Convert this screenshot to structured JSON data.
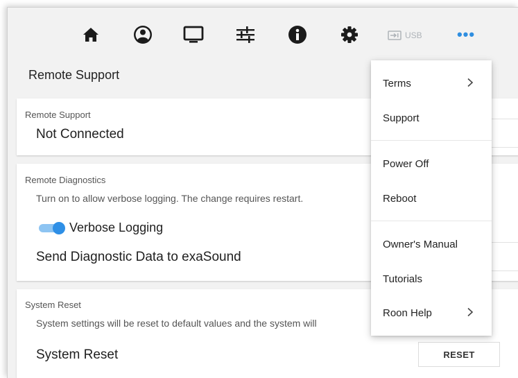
{
  "toolbar": {
    "icons": [
      "home-icon",
      "profile-icon",
      "monitor-icon",
      "sliders-icon",
      "info-icon",
      "gear-icon"
    ],
    "usb_label": "USB",
    "more_label": "•••",
    "accent_color": "#2f8ee0"
  },
  "page": {
    "title": "Remote Support"
  },
  "remote_support": {
    "label": "Remote Support",
    "status": "Not Connected"
  },
  "remote_diagnostics": {
    "label": "Remote Diagnostics",
    "description": "Turn on to allow verbose logging. The change requires restart.",
    "verbose_logging_label": "Verbose Logging",
    "verbose_logging_on": true,
    "send_label": "Send Diagnostic Data to exaSound"
  },
  "system_reset": {
    "label": "System Reset",
    "description": "System settings will be reset to default values and the system will",
    "title": "System Reset",
    "button_label": "RESET"
  },
  "menu": {
    "items": [
      {
        "label": "Terms",
        "has_submenu": true
      },
      {
        "label": "Support",
        "has_submenu": false
      },
      {
        "label": "Power Off",
        "has_submenu": false
      },
      {
        "label": "Reboot",
        "has_submenu": false
      },
      {
        "label": "Owner's Manual",
        "has_submenu": false
      },
      {
        "label": "Tutorials",
        "has_submenu": false
      },
      {
        "label": "Roon Help",
        "has_submenu": true
      }
    ]
  }
}
